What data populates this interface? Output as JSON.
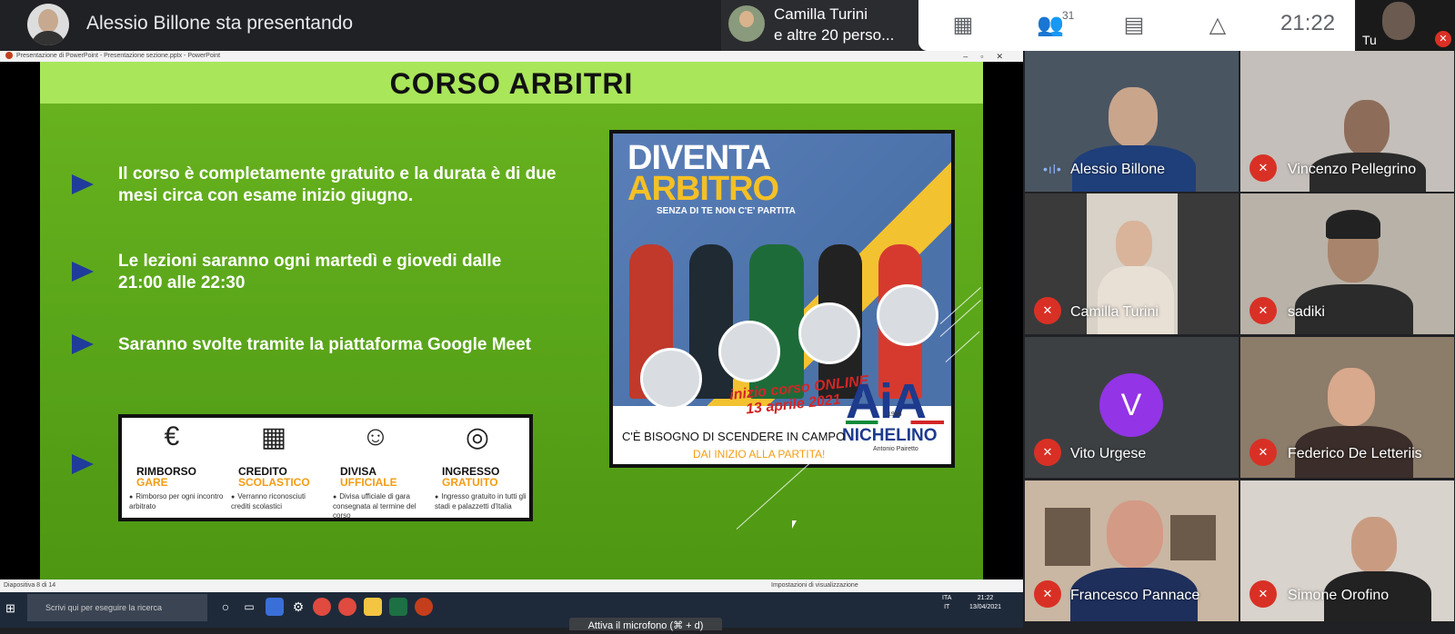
{
  "header": {
    "presenting_text": "Alessio Billone sta presentando",
    "chip_line1": "Camilla Turini",
    "chip_line2": "e altre 20 perso...",
    "participants_count": "31",
    "clock": "21:22",
    "self_label": "Tu"
  },
  "powerpoint": {
    "titlebar": "Presentazione di PowerPoint  -  Presentazione sezione.pptx  -  PowerPoint",
    "status_left": "Diapositiva 8 di 14",
    "status_right": "Impostazioni di visualizzazione"
  },
  "slide": {
    "title": "CORSO ARBITRI",
    "bullets": [
      {
        "line1": "Il corso è completamente gratuito  e la durata è di due",
        "line2": "mesi circa con esame inizio giugno."
      },
      {
        "line1": "Le lezioni saranno ogni martedì e giovedi dalle",
        "line2": "21:00 alle 22:30"
      },
      {
        "line1": "Saranno svolte tramite la piattaforma Google Meet",
        "line2": ""
      }
    ],
    "poster": {
      "line1": "DIVENTA",
      "line2": "ARBITRO",
      "tagline": "SENZA DI TE NON C'E' PARTITA",
      "red1": "inizio corso ONLINE",
      "red2": "13 aprile 2021",
      "org": "AiA",
      "org_year": "1986",
      "city": "NICHELINO",
      "author": "Antonio Pairetto",
      "bottom1": "C'È BISOGNO DI SCENDERE IN CAMPO",
      "bottom2": "DAI INIZIO ALLA PARTITA!"
    },
    "benefits": [
      {
        "t1": "RIMBORSO",
        "t2": "GARE",
        "desc": "Rimborso per ogni incontro arbitrato",
        "icon": "€"
      },
      {
        "t1": "CREDITO",
        "t2": "SCOLASTICO",
        "desc": "Verranno riconosciuti crediti scolastici",
        "icon": "▦"
      },
      {
        "t1": "DIVISA",
        "t2": "UFFICIALE",
        "desc": "Divisa ufficiale di gara consegnata al termine del corso",
        "icon": "☺"
      },
      {
        "t1": "INGRESSO",
        "t2": "GRATUITO",
        "desc": "Ingresso gratuito in tutti gli stadi e palazzetti d'Italia",
        "icon": "◎"
      }
    ]
  },
  "taskbar": {
    "search_placeholder": "Scrivi qui per eseguire la ricerca",
    "lang1": "ITA",
    "lang2": "IT",
    "time": "21:22",
    "date": "13/04/2021"
  },
  "toast": "Attiva il microfono (⌘ + d)",
  "participants": [
    {
      "name": "Alessio Billone",
      "muted": false
    },
    {
      "name": "Vincenzo Pellegrino",
      "muted": true
    },
    {
      "name": "Camilla Turini",
      "muted": true
    },
    {
      "name": "sadiki",
      "muted": true
    },
    {
      "name": "Vito Urgese",
      "muted": true,
      "initial": "V"
    },
    {
      "name": "Federico De Letteriis",
      "muted": true
    },
    {
      "name": "Francesco Pannace",
      "muted": true
    },
    {
      "name": "Simone Orofino",
      "muted": true
    }
  ],
  "colors": {
    "meet_bg": "#202124",
    "mic_off": "#d93025",
    "avatar_purple": "#9334e6",
    "slide_green": "#5aa61a",
    "slide_header": "#a9e65a"
  }
}
